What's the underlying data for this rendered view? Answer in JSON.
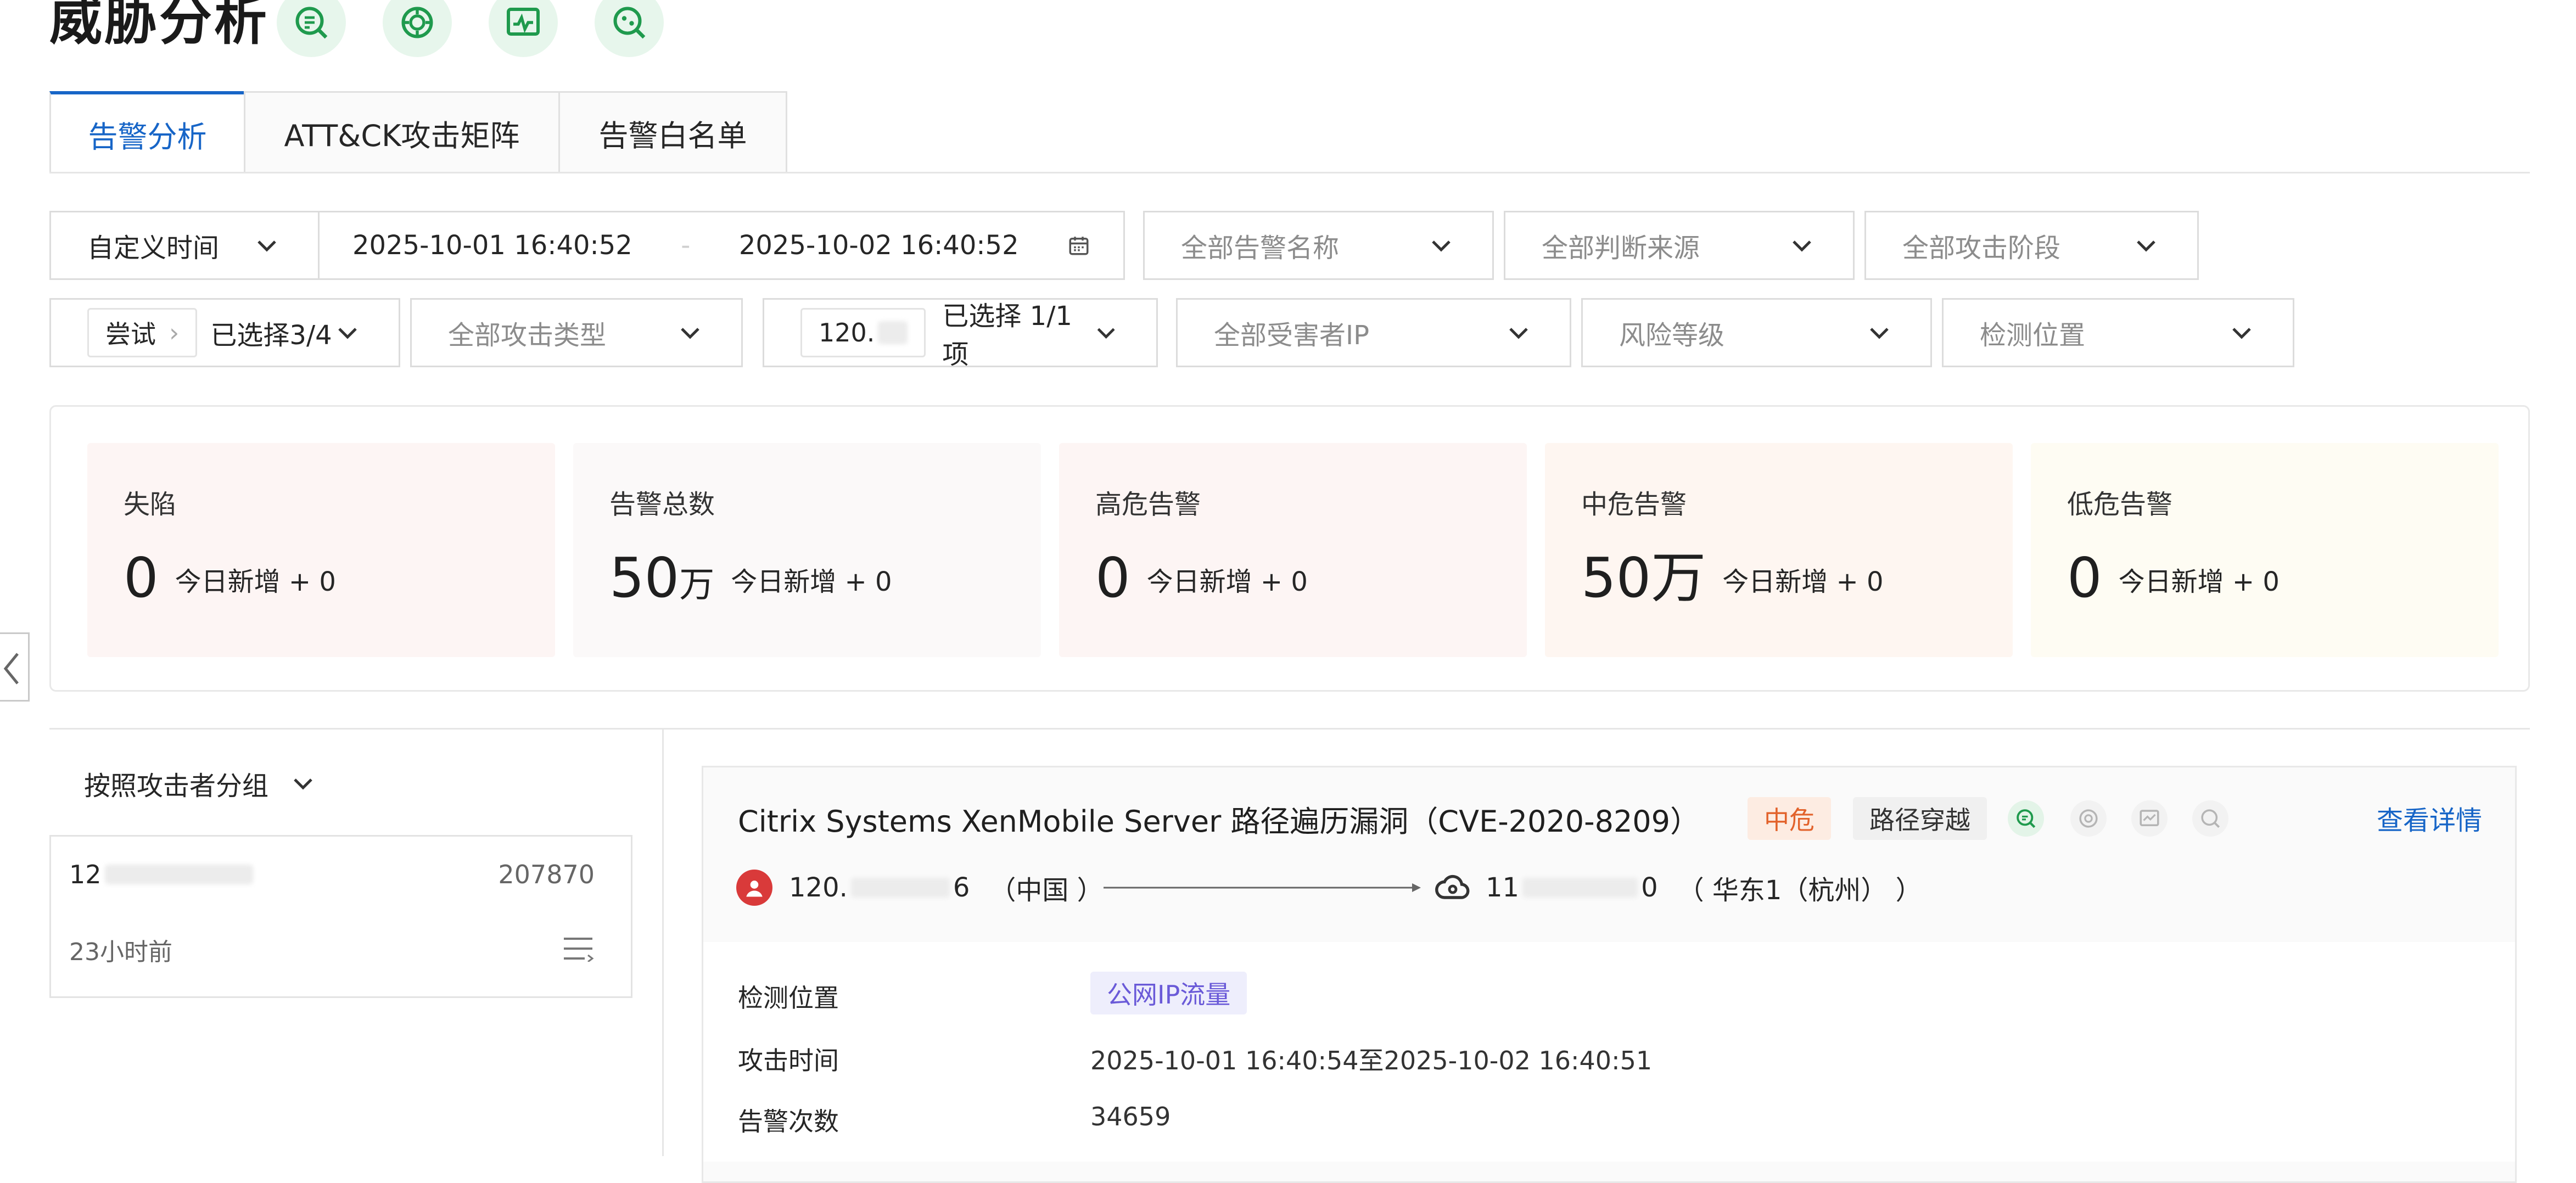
{
  "page": {
    "title": "威胁分析"
  },
  "header_icons": [
    "search-report-icon",
    "radar-icon",
    "chart-monitor-icon",
    "threat-scan-icon"
  ],
  "tabs": [
    {
      "label": "告警分析",
      "active": true
    },
    {
      "label": "ATT&CK攻击矩阵",
      "active": false
    },
    {
      "label": "告警白名单",
      "active": false
    }
  ],
  "filters": {
    "time_type": "自定义时间",
    "start_time": "2025-10-01 16:40:52",
    "range_sep": "-",
    "end_time": "2025-10-02 16:40:52",
    "alert_name": "全部告警名称",
    "judge_source": "全部判断来源",
    "attack_stage": "全部攻击阶段",
    "source_tag": "尝试",
    "source_selected": "已选择3/4",
    "attack_type": "全部攻击类型",
    "ip_tag": "120.",
    "ip_selected": "已选择 1/1 项",
    "victim_ip": "全部受害者IP",
    "risk_level": "风险等级",
    "detect_position": "检测位置"
  },
  "stats": [
    {
      "label": "失陷",
      "value": "0",
      "unit": "",
      "increment": "今日新增 + 0",
      "bg": "#fdf5f4"
    },
    {
      "label": "告警总数",
      "value": "50",
      "unit": "万",
      "increment": "今日新增 + 0",
      "bg": "#fbf9f9"
    },
    {
      "label": "高危告警",
      "value": "0",
      "unit": "",
      "increment": "今日新增 + 0",
      "bg": "#fdf5f4"
    },
    {
      "label": "中危告警",
      "value": "50万",
      "unit": "",
      "increment": "今日新增 + 0",
      "bg": "#fef6f1"
    },
    {
      "label": "低危告警",
      "value": "0",
      "unit": "",
      "increment": "今日新增 + 0",
      "bg": "#fefcf3"
    }
  ],
  "grouping": {
    "label": "按照攻击者分组",
    "item": {
      "ip": "12",
      "count": "207870",
      "time": "23小时前"
    }
  },
  "alert": {
    "title": "Citrix Systems XenMobile Server 路径遍历漏洞（CVE-2020-8209）",
    "severity": "中危",
    "category": "路径穿越",
    "view_details": "查看详情",
    "attacker_ip_prefix": "120.",
    "attacker_ip_suffix": "6",
    "attacker_location": "（中国 ）",
    "victim_ip_prefix": "11",
    "victim_ip_suffix": "0",
    "victim_location": "（ 华东1（杭州） ）",
    "fields": [
      {
        "label": "检测位置",
        "value": "公网IP流量",
        "tag": true
      },
      {
        "label": "攻击时间",
        "value": "2025-10-01 16:40:54至2025-10-02 16:40:51",
        "tag": false
      },
      {
        "label": "告警次数",
        "value": "34659",
        "tag": false
      }
    ]
  },
  "colors": {
    "accent": "#1765c7",
    "green": "#1f9a4d",
    "severity_mid": "#e2622b"
  }
}
